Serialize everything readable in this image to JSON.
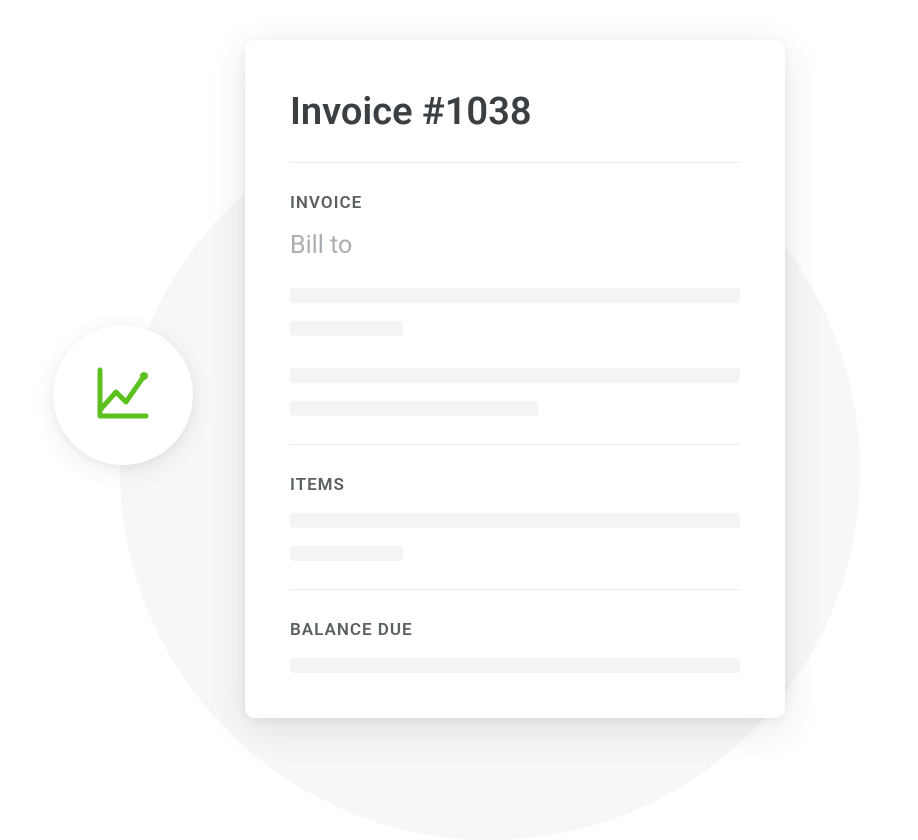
{
  "title": "Invoice #1038",
  "sections": {
    "invoice": {
      "label": "INVOICE",
      "bill_to_label": "Bill to"
    },
    "items": {
      "label": "ITEMS"
    },
    "balance": {
      "label": "BALANCE DUE"
    }
  },
  "icons": {
    "chart": "line-chart-icon"
  },
  "colors": {
    "accent": "#5cc11e"
  }
}
